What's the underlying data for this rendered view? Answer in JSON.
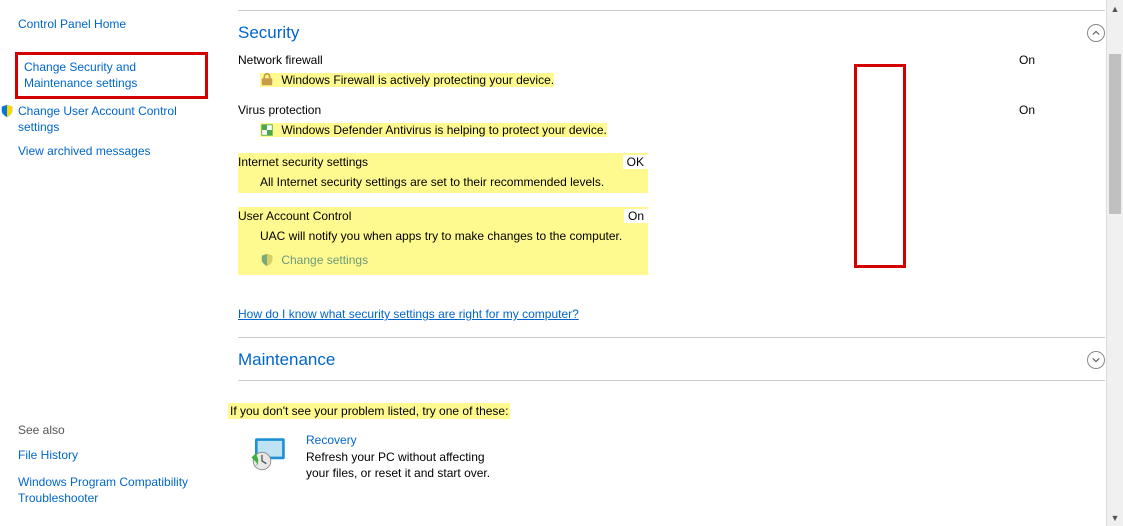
{
  "sidebar": {
    "home": "Control Panel Home",
    "links": [
      "Change Security and Maintenance settings",
      "Change User Account Control settings",
      "View archived messages"
    ],
    "see_also_heading": "See also",
    "see_also": [
      "File History",
      "Windows Program Compatibility Troubleshooter"
    ]
  },
  "security": {
    "title": "Security",
    "network_firewall": {
      "label": "Network firewall",
      "status": "On",
      "detail": "Windows Firewall is actively protecting your device."
    },
    "virus_protection": {
      "label": "Virus protection",
      "status": "On",
      "detail": "Windows Defender Antivirus is helping to protect your device."
    },
    "internet_security": {
      "label": "Internet security settings",
      "status": "OK",
      "detail": "All Internet security settings are set to their recommended levels."
    },
    "uac": {
      "label": "User Account Control",
      "status": "On",
      "detail": "UAC will notify you when apps try to make changes to the computer.",
      "change_link": "Change settings"
    },
    "help_link": "How do I know what security settings are right for my computer?"
  },
  "maintenance": {
    "title": "Maintenance"
  },
  "footer": {
    "note": "If you don't see your problem listed, try one of these:",
    "recovery_title": "Recovery",
    "recovery_desc": "Refresh your PC without affecting your files, or reset it and start over."
  }
}
